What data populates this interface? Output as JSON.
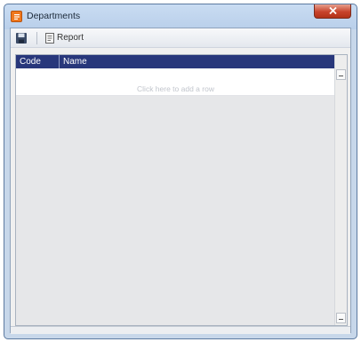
{
  "window": {
    "title": "Departments",
    "close_label": "Close"
  },
  "toolbar": {
    "save_icon": "save-icon",
    "report_icon": "report-icon",
    "report_label": "Report"
  },
  "grid": {
    "columns": [
      "Code",
      "Name"
    ],
    "rows": [],
    "add_row_prompt": "Click here to add a row"
  },
  "colors": {
    "header_bg": "#28377b",
    "accent": "#f0781e",
    "close_button": "#c8432c"
  }
}
